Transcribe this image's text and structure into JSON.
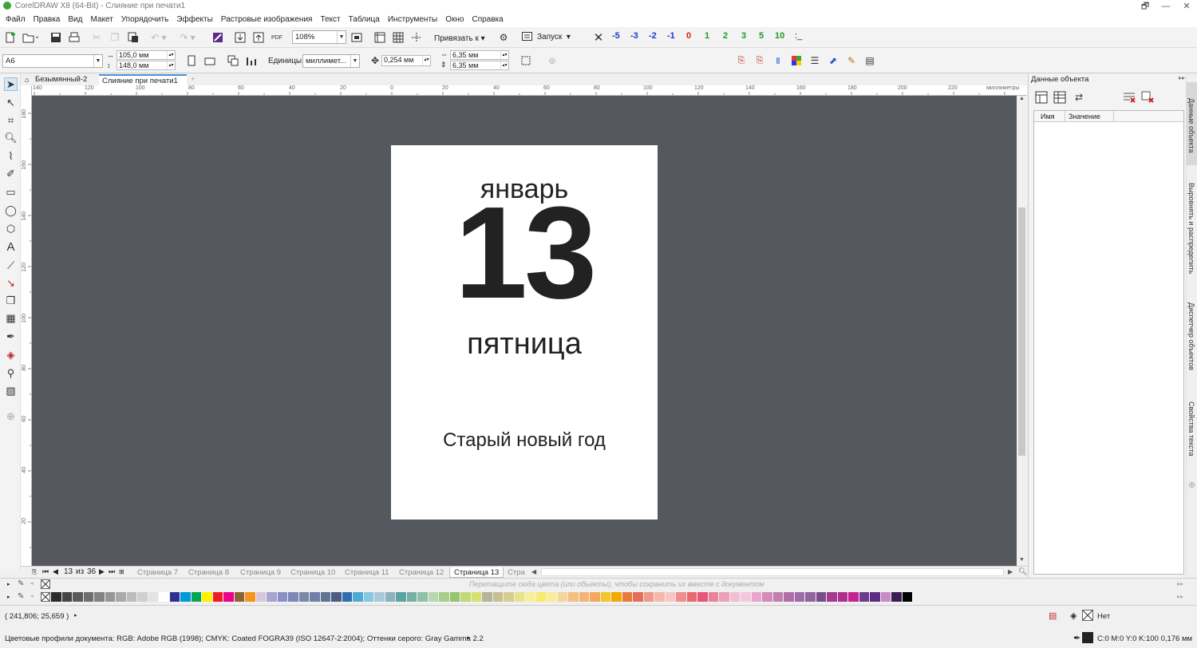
{
  "window": {
    "title": "CorelDRAW X8 (64-Bit) - Слияние при печати1",
    "controls": [
      "🗗",
      "—",
      "✕"
    ]
  },
  "menu": [
    "Файл",
    "Правка",
    "Вид",
    "Макет",
    "Упорядочить",
    "Эффекты",
    "Растровые изображения",
    "Текст",
    "Таблица",
    "Инструменты",
    "Окно",
    "Справка"
  ],
  "toolbar": {
    "zoom": "108%",
    "snap_label": "Привязать к",
    "launch_label": "Запуск",
    "numbers": [
      {
        "label": "-5",
        "color": "#1a3bd6"
      },
      {
        "label": "-3",
        "color": "#1a3bd6"
      },
      {
        "label": "-2",
        "color": "#1a3bd6"
      },
      {
        "label": "-1",
        "color": "#1a3bd6"
      },
      {
        "label": "0",
        "color": "#d61a1a"
      },
      {
        "label": "1",
        "color": "#1f9b1f"
      },
      {
        "label": "2",
        "color": "#1f9b1f"
      },
      {
        "label": "3",
        "color": "#1f9b1f"
      },
      {
        "label": "5",
        "color": "#1f9b1f"
      },
      {
        "label": "10",
        "color": "#1f9b1f"
      }
    ],
    "extra_label": ":_"
  },
  "propbar": {
    "page_size": "A6",
    "width": "105,0 мм",
    "height": "148,0 мм",
    "units_label": "Единицы:",
    "units_value": "миллимет...",
    "nudge": "0,254 мм",
    "dup_x": "6,35 мм",
    "dup_y": "6,35 мм"
  },
  "doc_tabs": [
    {
      "label": "Безымянный-2",
      "active": false
    },
    {
      "label": "Слияние при печати1",
      "active": true
    }
  ],
  "ruler": {
    "unit": "миллиметры",
    "h_ticks": [
      "140",
      "120",
      "100",
      "80",
      "60",
      "40",
      "20",
      "0",
      "20",
      "40",
      "60",
      "80",
      "100",
      "120",
      "140",
      "160",
      "180",
      "200",
      "220"
    ],
    "v_ticks": [
      "180",
      "160",
      "140",
      "120",
      "100",
      "80",
      "60",
      "40",
      "20",
      "0"
    ]
  },
  "page_content": {
    "month": "январь",
    "day": "13",
    "weekday": "пятница",
    "holiday": "Старый новый год"
  },
  "page_nav": {
    "current": "13",
    "of_label": "из",
    "total": "36",
    "pages": [
      "Страница 7",
      "Страница 8",
      "Страница 9",
      "Страница 10",
      "Страница 11",
      "Страница 12",
      "Страница 13",
      "Стра"
    ],
    "active_page": "Страница 13"
  },
  "panel": {
    "title": "Данные объекта",
    "col_name": "Имя",
    "col_value": "Значение"
  },
  "side_tabs": [
    "Данные объекта",
    "Выровнять и распределить",
    "Диспетчер объектов",
    "Свойства текста"
  ],
  "palette": {
    "doc_palette_hint": "Перетащите сюда цвета (или объекты), чтобы сохранить их вместе с документом",
    "colors": [
      "#2b2b2b",
      "#444444",
      "#5a5a5a",
      "#6e6e6e",
      "#828282",
      "#969696",
      "#aaaaaa",
      "#bdbdbd",
      "#d0d0d0",
      "#e3e3e3",
      "#ffffff",
      "#2e3192",
      "#0099da",
      "#00a651",
      "#fff200",
      "#ed1c24",
      "#ec008c",
      "#8c6239",
      "#f7941d",
      "#d7c7d8",
      "#a8a3cf",
      "#8a8fc5",
      "#7c86b8",
      "#7b89a6",
      "#6f7fa6",
      "#5f7395",
      "#4c5b83",
      "#2f6fb1",
      "#4ea9d6",
      "#88c7e4",
      "#a8c9d8",
      "#8bb2bd",
      "#58a3a4",
      "#74b1a2",
      "#8fc1a9",
      "#b7d7ae",
      "#a6ce8d",
      "#95c56d",
      "#c3d979",
      "#d7e16c",
      "#b5b49a",
      "#c6c093",
      "#d4cf8f",
      "#e8e28f",
      "#f7f099",
      "#f6eb6c",
      "#fbec9a",
      "#f4d59c",
      "#f2c081",
      "#f5b37a",
      "#f6a660",
      "#f3c62c",
      "#f2a900",
      "#ea7a3c",
      "#e46e59",
      "#f09a8c",
      "#f5b8a9",
      "#f6c7c0",
      "#ef8d8d",
      "#e96a6a",
      "#e6557c",
      "#e9829b",
      "#ee9fb5",
      "#f3bfd0",
      "#f5c6e0",
      "#e8a6ca",
      "#d48bb8",
      "#c17fb0",
      "#b06ea8",
      "#a06bad",
      "#8f659c",
      "#7a4e8e",
      "#a4398d",
      "#b0308f",
      "#c7238f",
      "#6d3b8e",
      "#5b2d82",
      "#c98bc5",
      "#3c1d52",
      "#000000"
    ]
  },
  "status": {
    "coords": "( 241,806; 25,659 )",
    "color_profiles": "Цветовые профили документа: RGB: Adobe RGB (1998); CMYK: Coated FOGRA39 (ISO 12647-2:2004); Оттенки серого: Gray Gamma 2.2",
    "fill_label": "Нет",
    "outline_info": "C:0 M:0 Y:0 K:100  0,176 мм"
  }
}
